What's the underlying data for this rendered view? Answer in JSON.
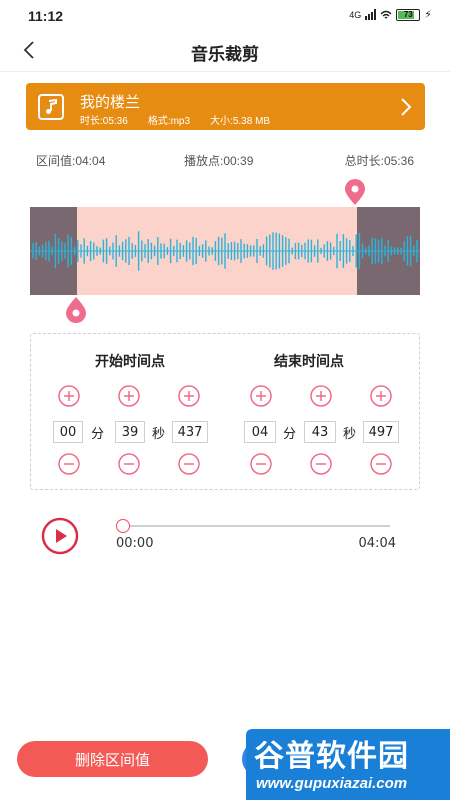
{
  "status_bar": {
    "time": "11:12",
    "network": "4G",
    "battery": "73"
  },
  "header": {
    "title": "音乐裁剪"
  },
  "song": {
    "name": "我的楼兰",
    "duration": "时长:05:36",
    "format": "格式:mp3",
    "size": "大小:5.38 MB"
  },
  "info": {
    "interval": "区间值:04:04",
    "play_point": "播放点:00:39",
    "total": "总时长:05:36"
  },
  "start_time": {
    "title": "开始时间点",
    "minutes": "00",
    "seconds": "39",
    "millis": "437",
    "min_unit": "分",
    "sec_unit": "秒"
  },
  "end_time": {
    "title": "结束时间点",
    "minutes": "04",
    "seconds": "43",
    "millis": "497",
    "min_unit": "分",
    "sec_unit": "秒"
  },
  "player": {
    "current": "00:00",
    "total": "04:04",
    "progress": 0
  },
  "actions": {
    "delete_label": "删除区间值"
  },
  "watermark": {
    "logo": "谷普软件园",
    "url": "www.gupuxiazai.com"
  },
  "colors": {
    "accent": "#e78c12",
    "pink": "#f06c8c",
    "wave": "#2bb4d8",
    "selection": "#fbd3cb",
    "danger": "#f45a55"
  }
}
